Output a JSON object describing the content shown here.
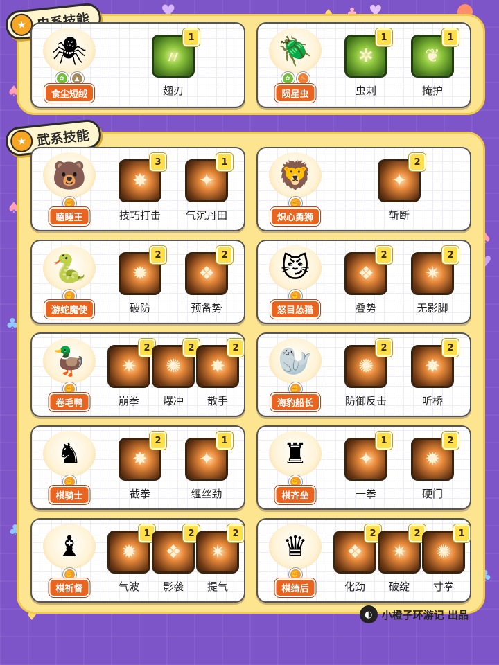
{
  "sections": {
    "bug": {
      "title": "虫系技能"
    },
    "fighting": {
      "title": "武系技能"
    }
  },
  "bug_cards": [
    {
      "name": "食尘短绒",
      "icon": "spider-pokemon",
      "skills": [
        {
          "name": "翅刃",
          "count": "1"
        }
      ]
    },
    {
      "name": "陨星虫",
      "icon": "meteor-bug-pokemon",
      "skills": [
        {
          "name": "虫刺",
          "count": "1"
        },
        {
          "name": "掩护",
          "count": "1"
        }
      ]
    }
  ],
  "fight_cards": [
    {
      "name": "瞌睡王",
      "icon": "sleepy-king-pokemon",
      "skills": [
        {
          "name": "技巧打击",
          "count": "3"
        },
        {
          "name": "气沉丹田",
          "count": "1"
        }
      ]
    },
    {
      "name": "炽心勇狮",
      "icon": "lion-pokemon",
      "skills": [
        {
          "name": "斩断",
          "count": "2"
        }
      ]
    },
    {
      "name": "游蛇魔使",
      "icon": "serpent-pokemon",
      "skills": [
        {
          "name": "破防",
          "count": "2"
        },
        {
          "name": "预备势",
          "count": "2"
        }
      ]
    },
    {
      "name": "怒目怂猫",
      "icon": "angry-cat-pokemon",
      "skills": [
        {
          "name": "叠势",
          "count": "2"
        },
        {
          "name": "无影脚",
          "count": "2"
        }
      ]
    },
    {
      "name": "卷毛鸭",
      "icon": "duck-pokemon",
      "skills": [
        {
          "name": "崩拳",
          "count": "2"
        },
        {
          "name": "爆冲",
          "count": "2"
        },
        {
          "name": "散手",
          "count": "2"
        }
      ]
    },
    {
      "name": "海豹船长",
      "icon": "seal-captain-pokemon",
      "skills": [
        {
          "name": "防御反击",
          "count": "2"
        },
        {
          "name": "听桥",
          "count": "2"
        }
      ]
    },
    {
      "name": "棋骑士",
      "icon": "chess-knight-pokemon",
      "skills": [
        {
          "name": "截拳",
          "count": "2"
        },
        {
          "name": "缠丝劲",
          "count": "1"
        }
      ]
    },
    {
      "name": "棋齐垒",
      "icon": "chess-rook-pokemon",
      "skills": [
        {
          "name": "一拳",
          "count": "1"
        },
        {
          "name": "硬门",
          "count": "2"
        }
      ]
    },
    {
      "name": "棋祈督",
      "icon": "chess-bishop-pokemon",
      "skills": [
        {
          "name": "气波",
          "count": "1"
        },
        {
          "name": "影袭",
          "count": "2"
        },
        {
          "name": "提气",
          "count": "2"
        }
      ]
    },
    {
      "name": "棋绮后",
      "icon": "chess-queen-pokemon",
      "skills": [
        {
          "name": "化劲",
          "count": "2"
        },
        {
          "name": "破绽",
          "count": "2"
        },
        {
          "name": "寸拳",
          "count": "1"
        }
      ]
    }
  ],
  "footer": {
    "text": "小橙子环游记 出品"
  }
}
